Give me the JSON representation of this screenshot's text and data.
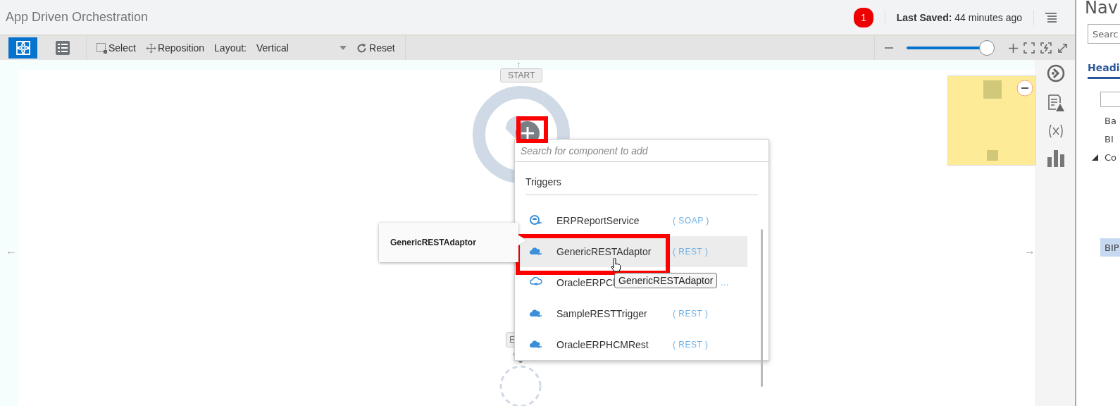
{
  "header": {
    "title": "App Driven Orchestration",
    "notification_count": "1",
    "last_saved_label": "Last Saved:",
    "last_saved_value": "44 minutes ago"
  },
  "toolbar": {
    "view_buttons": [
      {
        "kind": "diagram",
        "selected": true
      },
      {
        "kind": "list",
        "selected": false
      }
    ],
    "actions": [
      {
        "kind": "select",
        "label": "Select"
      },
      {
        "kind": "reposition",
        "label": "Reposition"
      }
    ],
    "layout_label": "Layout:",
    "layout_value": "Vertical",
    "reset_label": "Reset",
    "zoom": {
      "level": 0.97
    }
  },
  "canvas": {
    "top_arrow": "↑",
    "left_arrow": "←",
    "right_arrow": "→",
    "start_label": "START",
    "end_label": "E",
    "drag_card": "GenericRESTAdaptor",
    "tooltip": "GenericRESTAdaptor",
    "popup": {
      "placeholder": "Search for component to add",
      "section": "Triggers",
      "items": [
        {
          "kind": "soap",
          "name": "ERPReportService",
          "tag": "( SOAP )",
          "selected": false
        },
        {
          "kind": "rest",
          "name": "GenericRESTAdaptor",
          "tag": "( REST )",
          "selected": true
        },
        {
          "kind": "erp",
          "name": "OracleERPCl",
          "tag": "...",
          "selected": false
        },
        {
          "kind": "rest",
          "name": "SampleRESTTrigger",
          "tag": "( REST )",
          "selected": false
        },
        {
          "kind": "rest",
          "name": "OracleERPHCMRest",
          "tag": "( REST )",
          "selected": false
        }
      ]
    }
  },
  "nav_pane": {
    "title": "Nav",
    "search_placeholder": "Searc",
    "tab": "Headi",
    "items": [
      {
        "label": "Ba",
        "selected": false
      },
      {
        "label": "BI",
        "selected": false
      },
      {
        "label": "Co",
        "expanded": true,
        "selected": false
      },
      {
        "label": "BIP",
        "selected": true
      }
    ]
  }
}
